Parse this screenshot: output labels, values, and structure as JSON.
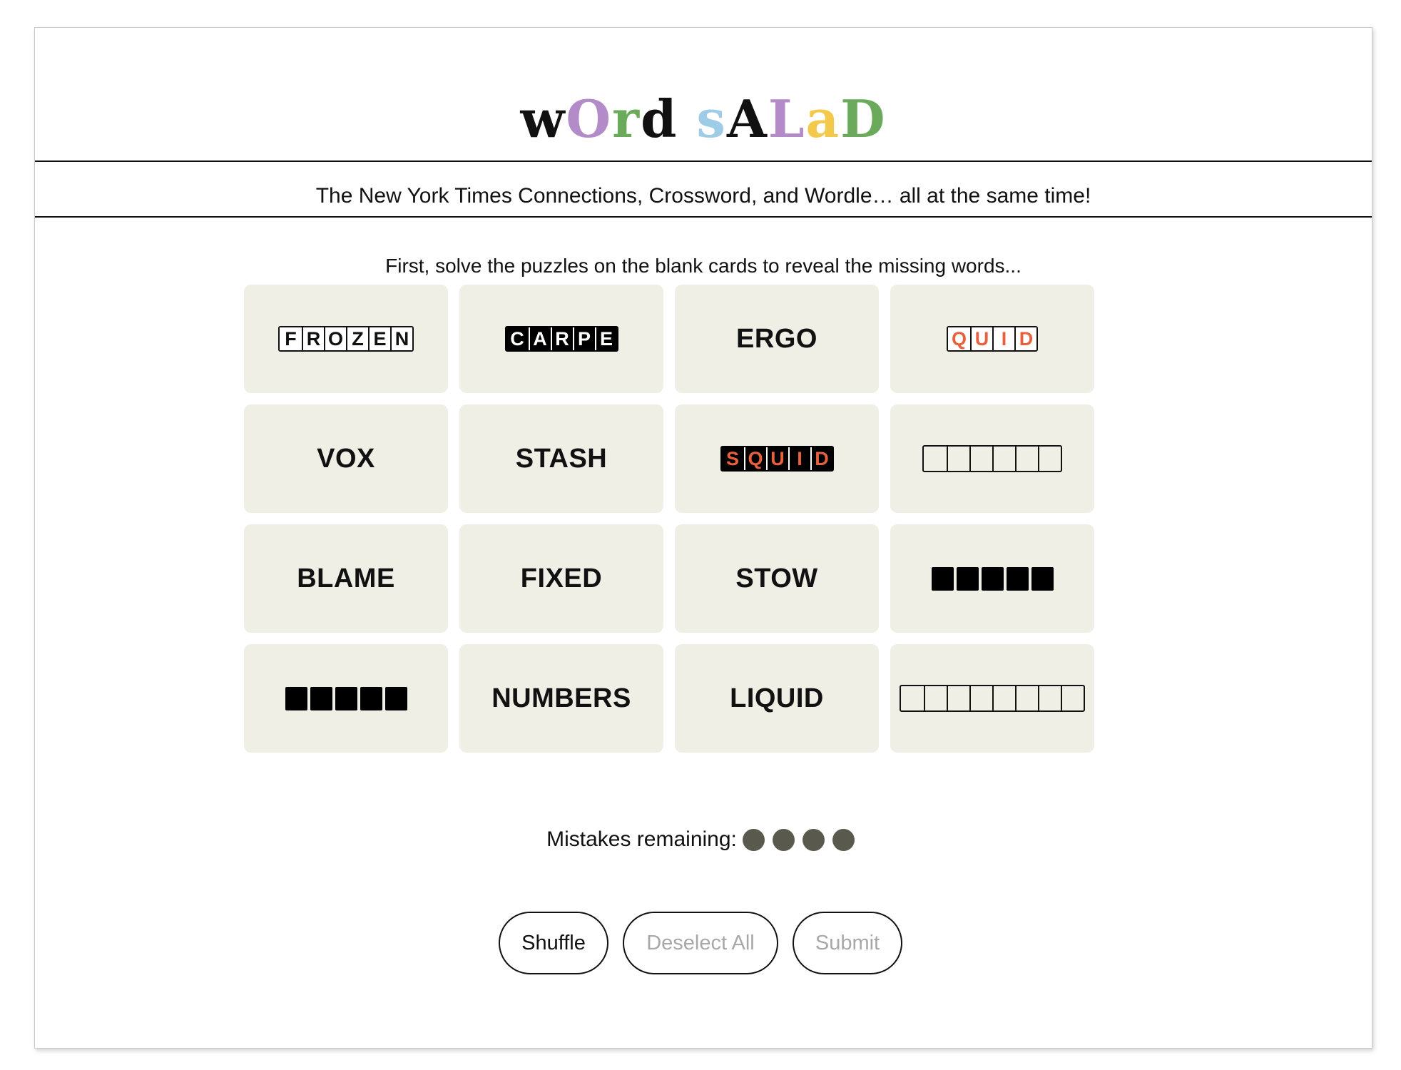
{
  "logo": {
    "letters": [
      {
        "ch": "w",
        "color": "#111111"
      },
      {
        "ch": "O",
        "color": "#b38bc9"
      },
      {
        "ch": "r",
        "color": "#6aaa5a"
      },
      {
        "ch": "d",
        "color": "#111111"
      },
      {
        "ch": " ",
        "color": ""
      },
      {
        "ch": "s",
        "color": "#9ecbe6"
      },
      {
        "ch": "A",
        "color": "#111111"
      },
      {
        "ch": "L",
        "color": "#b38bc9"
      },
      {
        "ch": "a",
        "color": "#f3c94b"
      },
      {
        "ch": "D",
        "color": "#6aaa5a"
      }
    ]
  },
  "subtitle": "The New York Times Connections, Crossword, and Wordle… all at the same time!",
  "instruction": "First, solve the puzzles on the blank cards to reveal the missing words...",
  "colors": {
    "card_bg": "#efefe6",
    "accent_orange": "#e8613c",
    "dot": "#5a594e"
  },
  "cards": [
    {
      "kind": "boxes",
      "style": "outline",
      "letters": [
        "F",
        "R",
        "O",
        "Z",
        "E",
        "N"
      ]
    },
    {
      "kind": "boxes",
      "style": "filled",
      "letters": [
        "C",
        "A",
        "R",
        "P",
        "E"
      ]
    },
    {
      "kind": "word",
      "text": "ERGO"
    },
    {
      "kind": "boxes",
      "style": "orange",
      "letters": [
        "Q",
        "U",
        "I",
        "D"
      ]
    },
    {
      "kind": "word",
      "text": "VOX"
    },
    {
      "kind": "word",
      "text": "STASH"
    },
    {
      "kind": "boxes",
      "style": "filled-orange",
      "letters": [
        "S",
        "Q",
        "U",
        "I",
        "D"
      ]
    },
    {
      "kind": "boxes",
      "style": "empty",
      "count": 6
    },
    {
      "kind": "word",
      "text": "BLAME"
    },
    {
      "kind": "word",
      "text": "FIXED"
    },
    {
      "kind": "word",
      "text": "STOW"
    },
    {
      "kind": "boxes",
      "style": "solid",
      "count": 5
    },
    {
      "kind": "boxes",
      "style": "solid",
      "count": 5
    },
    {
      "kind": "word",
      "text": "NUMBERS"
    },
    {
      "kind": "word",
      "text": "LIQUID"
    },
    {
      "kind": "boxes",
      "style": "empty",
      "count": 8
    }
  ],
  "mistakes": {
    "label": "Mistakes remaining:",
    "remaining": 4
  },
  "buttons": {
    "shuffle": "Shuffle",
    "deselect_all": "Deselect All",
    "submit": "Submit"
  }
}
